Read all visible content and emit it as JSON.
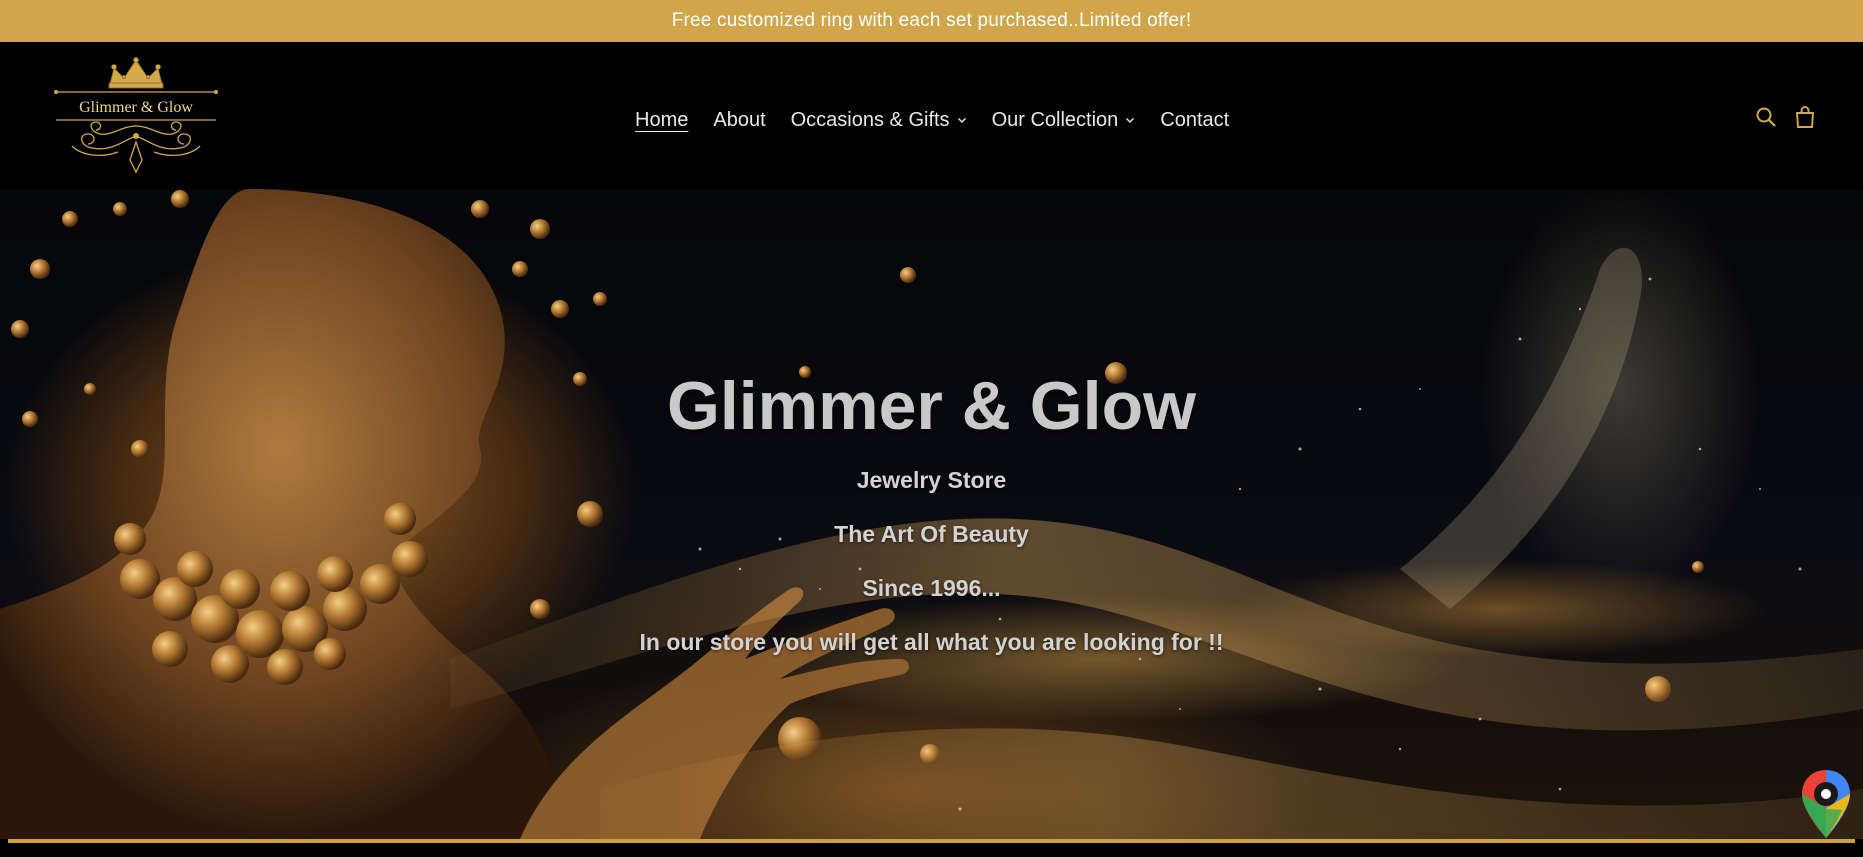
{
  "announcement": {
    "text": "Free customized ring with each set purchased..Limited offer!"
  },
  "logo": {
    "text": "Glimmer & Glow",
    "icon": "crown-logo-icon"
  },
  "nav": {
    "items": [
      {
        "label": "Home",
        "active": true
      },
      {
        "label": "About"
      },
      {
        "label": "Occasions & Gifts",
        "dropdown": true
      },
      {
        "label": "Our Collection",
        "dropdown": true
      },
      {
        "label": "Contact"
      }
    ]
  },
  "header_icons": {
    "search": "search-icon",
    "cart": "cart-icon"
  },
  "hero": {
    "title": "Glimmer & Glow",
    "lines": [
      "Jewelry Store",
      "The Art Of Beauty",
      "Since 1996...",
      "In our store you will get all what you are looking for !!"
    ]
  },
  "floating": {
    "icon": "google-maps-icon"
  },
  "colors": {
    "announcement_bg": "#d1a64a",
    "header_bg": "#000000",
    "gold_accent": "#c9a13f",
    "icon_gold": "#d4a94a"
  }
}
